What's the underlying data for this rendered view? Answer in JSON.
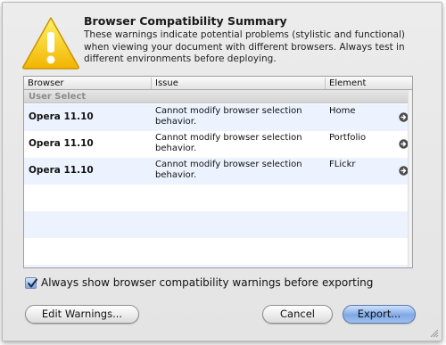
{
  "dialog": {
    "title": "Browser Compatibility Summary",
    "description": "These warnings indicate potential problems (stylistic and functional) when viewing your document with different browsers.  Always test in different environments before deploying."
  },
  "table": {
    "columns": [
      "Browser",
      "Issue",
      "Element"
    ],
    "group": "User Select",
    "rows": [
      {
        "browser": "Opera 11.10",
        "issue": "Cannot modify browser selection behavior.",
        "element": "Home"
      },
      {
        "browser": "Opera 11.10",
        "issue": "Cannot modify browser selection behavior.",
        "element": "Portfolio"
      },
      {
        "browser": "Opera 11.10",
        "issue": "Cannot modify browser selection behavior.",
        "element": "FLickr"
      }
    ]
  },
  "checkbox": {
    "label": "Always show browser compatibility warnings before exporting",
    "checked": true
  },
  "buttons": {
    "edit": "Edit Warnings...",
    "cancel": "Cancel",
    "export": "Export..."
  },
  "icons": {
    "warning": "warning-triangle-icon",
    "row_action": "go-arrow-icon"
  },
  "colors": {
    "warning_yellow": "#f5c400",
    "row_stripe": "#edf3fe",
    "default_button": "#7fa9e6"
  }
}
